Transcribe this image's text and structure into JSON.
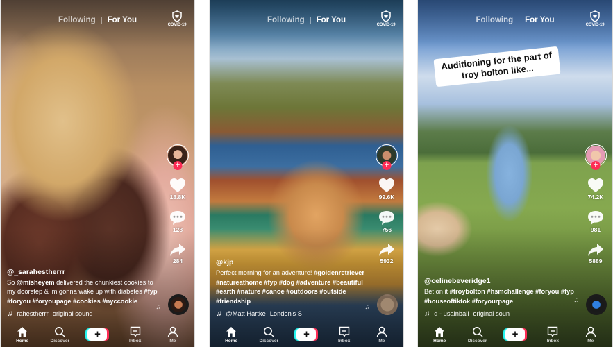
{
  "feed_tabs": {
    "following": "Following",
    "for_you": "For You",
    "active": "For You"
  },
  "covid_label": "COVID-19",
  "nav": {
    "home": "Home",
    "discover": "Discover",
    "create": "+",
    "inbox": "Inbox",
    "me": "Me"
  },
  "colors": {
    "accent_red": "#fe2c55",
    "accent_cyan": "#25f4ee",
    "text": "#ffffff"
  },
  "posts": [
    {
      "username": "@_sarahestherrr",
      "caption_parts": [
        {
          "text": "So ",
          "bold": false
        },
        {
          "text": "@misheyem",
          "bold": true
        },
        {
          "text": " delivered the chunkiest cookies to my doorstep & im gonna wake up with diabetes ",
          "bold": false
        },
        {
          "text": "#fyp #foryou #foryoupage #cookies #nyccookie",
          "bold": true
        }
      ],
      "sound_author": "rahestherrr",
      "sound_title": "original sound",
      "likes": "18.8K",
      "comments": "128",
      "shares": "284",
      "overlay_text": null
    },
    {
      "username": "@kjp",
      "caption_parts": [
        {
          "text": "Perfect morning for an adventure! ",
          "bold": false
        },
        {
          "text": "#goldenretriever #natureathome #fyp #dog #adventure #beautiful #earth #nature #canoe #outdoors #outside #friendship",
          "bold": true
        }
      ],
      "sound_author": "@Matt Hartke",
      "sound_title": "London's S",
      "likes": "99.6K",
      "comments": "756",
      "shares": "5932",
      "overlay_text": null
    },
    {
      "username": "@celinebeveridge1",
      "caption_parts": [
        {
          "text": "Bet on it ",
          "bold": false
        },
        {
          "text": "#troybolton #hsmchallenge #foryou #fyp #houseoftiktok #foryourpage",
          "bold": true
        }
      ],
      "sound_author": "d - usainball",
      "sound_title": "original soun",
      "likes": "74.2K",
      "comments": "981",
      "shares": "5889",
      "overlay_text": "Auditioning for the part of troy bolton like..."
    }
  ]
}
